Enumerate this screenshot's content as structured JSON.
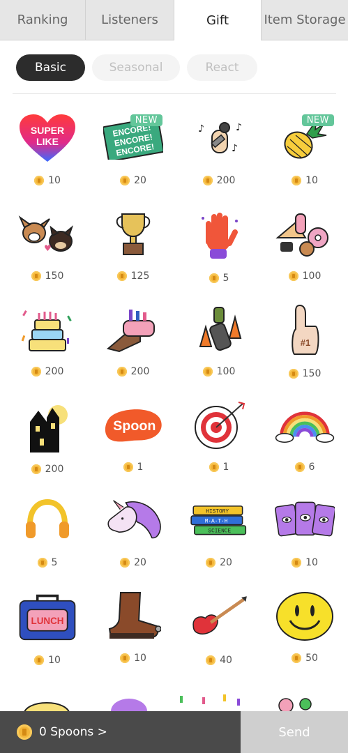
{
  "tabs": [
    {
      "label": "Ranking"
    },
    {
      "label": "Listeners"
    },
    {
      "label": "Gift"
    },
    {
      "label": "Item Storage"
    }
  ],
  "subtabs": [
    {
      "label": "Basic"
    },
    {
      "label": "Seasonal"
    },
    {
      "label": "React"
    }
  ],
  "gifts": [
    {
      "name": "super-like",
      "price": "10"
    },
    {
      "name": "encore",
      "price": "20",
      "badge": "NEW"
    },
    {
      "name": "microphone-hand",
      "price": "200"
    },
    {
      "name": "pineapple",
      "price": "10",
      "badge": "NEW"
    },
    {
      "name": "dogs",
      "price": "150"
    },
    {
      "name": "trophy",
      "price": "125"
    },
    {
      "name": "magic-hand",
      "price": "5"
    },
    {
      "name": "food",
      "price": "100"
    },
    {
      "name": "cake",
      "price": "200"
    },
    {
      "name": "makeup-hand",
      "price": "200"
    },
    {
      "name": "traffic-cones",
      "price": "100"
    },
    {
      "name": "foam-finger",
      "price": "150"
    },
    {
      "name": "haunted-house",
      "price": "200"
    },
    {
      "name": "spoon-logo",
      "price": "1"
    },
    {
      "name": "target",
      "price": "1"
    },
    {
      "name": "rainbow",
      "price": "6"
    },
    {
      "name": "headphones",
      "price": "5"
    },
    {
      "name": "unicorn",
      "price": "20"
    },
    {
      "name": "books",
      "price": "20"
    },
    {
      "name": "tarot-cards",
      "price": "10"
    },
    {
      "name": "lunchbox",
      "price": "10"
    },
    {
      "name": "boot",
      "price": "10"
    },
    {
      "name": "guitar",
      "price": "40"
    },
    {
      "name": "smiley",
      "price": "50"
    }
  ],
  "gift_text": {
    "super_like_line1": "SUPER",
    "super_like_line2": "LIKE",
    "encore_1": "ENCORE!",
    "encore_2": "ENCORE!",
    "encore_3": "ENCORE!",
    "spoon": "Spoon",
    "books_1": "HISTORY",
    "books_2": "M·A·T·H",
    "books_3": "SCIENCE",
    "lunch": "LUNCH",
    "finger_num": "#1"
  },
  "wallet": {
    "label": "0 Spoons >"
  },
  "send": {
    "label": "Send"
  },
  "colors": {
    "coin": "#f4b63a",
    "badge": "#63c69a",
    "dark": "#2c2c2c"
  }
}
